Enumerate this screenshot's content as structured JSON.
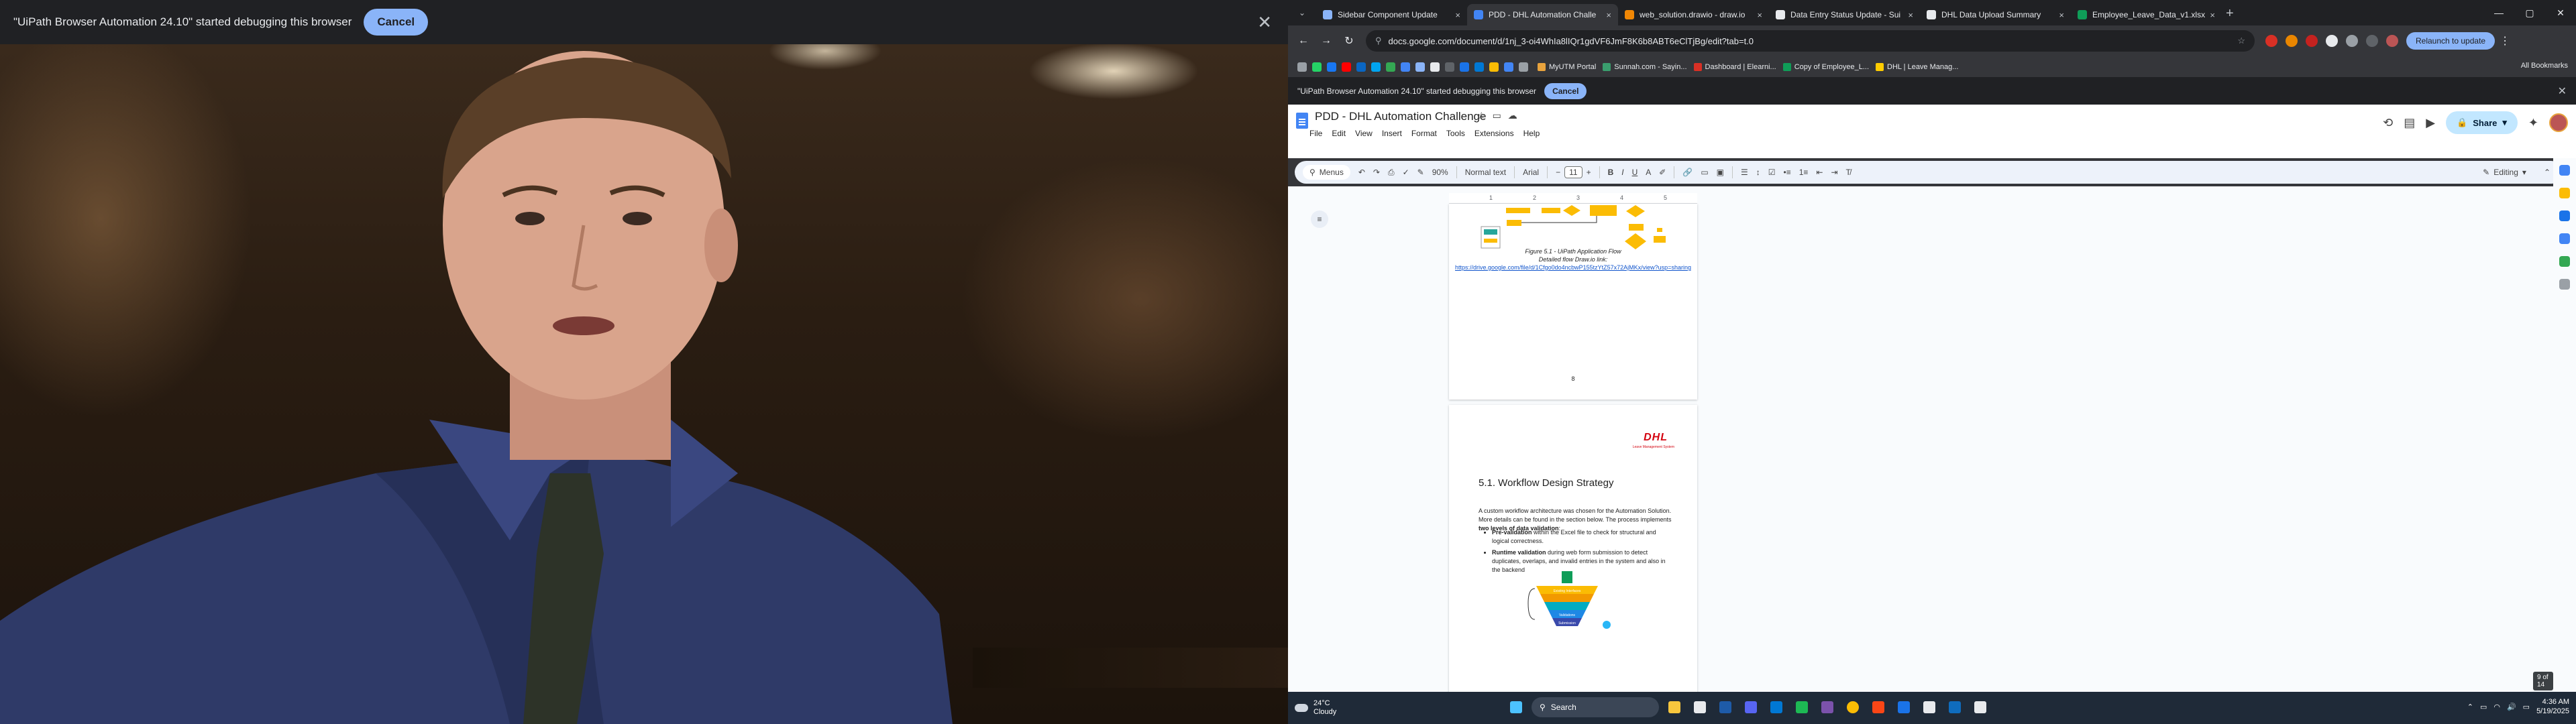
{
  "left_debug_bar": {
    "message": "\"UiPath Browser Automation 24.10\" started debugging this browser",
    "cancel_label": "Cancel",
    "close_label": "✕"
  },
  "tabs": [
    {
      "label": "Sidebar Component Update",
      "color": "#8ab4f8",
      "active": false
    },
    {
      "label": "PDD - DHL Automation Challe",
      "color": "#4285f4",
      "active": true
    },
    {
      "label": "web_solution.drawio - draw.io",
      "color": "#f08705",
      "active": false
    },
    {
      "label": "Data Entry Status Update - Sui",
      "color": "#e8eaed",
      "active": false
    },
    {
      "label": "DHL Data Upload Summary",
      "color": "#e8eaed",
      "active": false
    },
    {
      "label": "Employee_Leave_Data_v1.xlsx",
      "color": "#0f9d58",
      "active": false
    }
  ],
  "tab_close": "×",
  "window_controls": {
    "minimize": "—",
    "maximize": "▢",
    "close": "✕"
  },
  "address_bar": {
    "url": "docs.google.com/document/d/1nj_3-oi4WhIa8lIQr1gdVF6JmF8K6b8ABT6eClTjBg/edit?tab=t.0"
  },
  "relaunch_label": "Relaunch to update",
  "bookmarks": [
    {
      "label": "MyUTM Portal",
      "color": "#e8a33d"
    },
    {
      "label": "Sunnah.com - Sayin...",
      "color": "#3a9e6e"
    },
    {
      "label": "Dashboard | Elearni...",
      "color": "#d93025"
    },
    {
      "label": "Copy of Employee_L...",
      "color": "#0f9d58"
    },
    {
      "label": "DHL | Leave Manag...",
      "color": "#ffcc00"
    }
  ],
  "all_bookmarks_label": "All Bookmarks",
  "right_debug_bar": {
    "message": "\"UiPath Browser Automation 24.10\" started debugging this browser",
    "cancel_label": "Cancel",
    "close_label": "✕"
  },
  "doc": {
    "title": "PDD - DHL Automation Challenge",
    "menus": [
      "File",
      "Edit",
      "View",
      "Insert",
      "Format",
      "Tools",
      "Extensions",
      "Help"
    ],
    "share_label": "Share"
  },
  "docs_toolbar": {
    "menus_label": "Menus",
    "zoom": "90%",
    "style": "Normal text",
    "font": "Arial",
    "font_size": "11",
    "mode": "Editing"
  },
  "page1": {
    "figure_caption": "Figure 5.1 - UiPath Application Flow",
    "figure_sub": "Detailed flow Draw.io link:",
    "figure_link": "https://drive.google.com/file/d/1Cfgo0do4ncbwP155tzYtZ57x72AjMKx/view?usp=sharing",
    "page_number": "8"
  },
  "page2": {
    "logo_text": "DHL",
    "logo_sub": "Leave Management System",
    "heading": "5.1. Workflow Design Strategy",
    "intro": "A custom workflow architecture was chosen for the Automation Solution. More details can be found in the section below. The process implements",
    "intro_bold": "two levels of data validation",
    "intro_end": ":",
    "bullet1_bold": "Pre-validation",
    "bullet1_rest": " within the Excel file to check for structural and logical correctness.",
    "bullet2_bold": "Runtime validation",
    "bullet2_rest": " during web form submission to detect duplicates, overlaps, and invalid entries in the system and also in the backend",
    "funnel_title": "Existing Interfaces",
    "funnel_levels": [
      "Validations",
      "Submission"
    ]
  },
  "page_counter": "9 of 14",
  "taskbar": {
    "weather_temp": "24°C",
    "weather_desc": "Cloudy",
    "search_label": "Search",
    "time": "4:36 AM",
    "date": "5/19/2025"
  }
}
